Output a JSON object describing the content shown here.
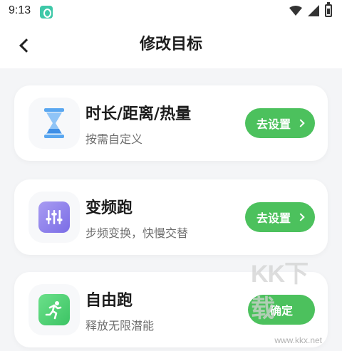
{
  "status_bar": {
    "time": "9:13",
    "icons": [
      "app-icon",
      "wifi-icon",
      "signal-icon",
      "battery-icon"
    ]
  },
  "header": {
    "title": "修改目标",
    "back_icon": "chevron-left-icon"
  },
  "cards": [
    {
      "title": "时长/距离/热量",
      "subtitle": "按需自定义",
      "icon": "hourglass-icon",
      "button_label": "去设置",
      "button_chevron": true
    },
    {
      "title": "变频跑",
      "subtitle": "步频变换，快慢交替",
      "icon": "sliders-icon",
      "button_label": "去设置",
      "button_chevron": true
    },
    {
      "title": "自由跑",
      "subtitle": "释放无限潜能",
      "icon": "runner-icon",
      "button_label": "确定",
      "button_chevron": false
    }
  ],
  "watermark": {
    "text": "KK下载",
    "url": "www.kkx.net"
  },
  "colors": {
    "accent": "#4cc15d",
    "background": "#f4f5f7",
    "card": "#ffffff"
  }
}
